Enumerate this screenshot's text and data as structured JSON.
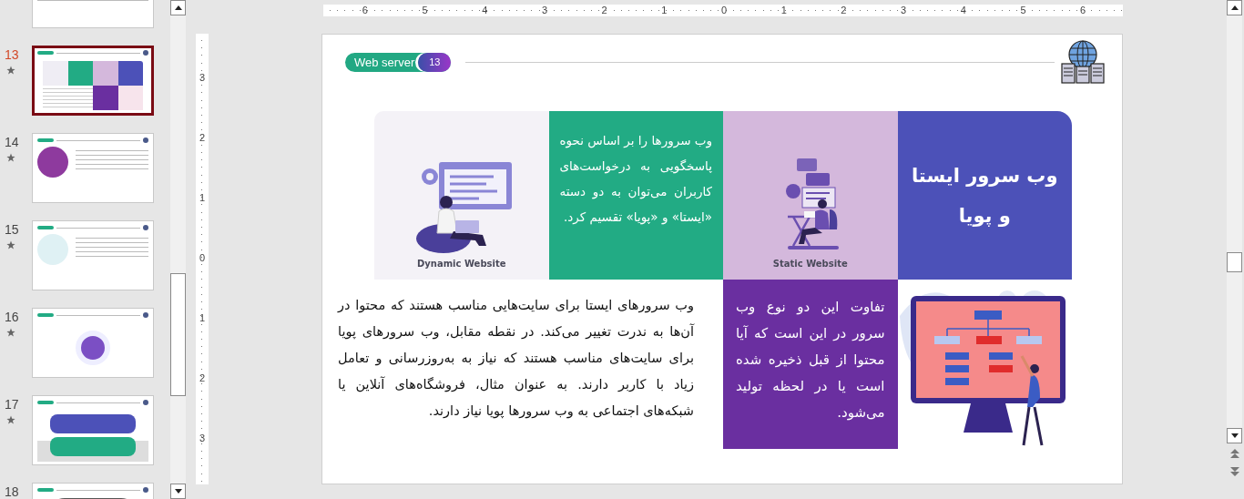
{
  "thumbnails": [
    {
      "kind": "text",
      "selected": false,
      "star": false
    },
    {
      "number": "13",
      "kind": "grid",
      "selected": true,
      "star": true
    },
    {
      "number": "14",
      "kind": "circle-list",
      "selected": false,
      "star": true
    },
    {
      "number": "15",
      "kind": "monitor-list",
      "selected": false,
      "star": true
    },
    {
      "number": "16",
      "kind": "diagram",
      "selected": false,
      "star": true
    },
    {
      "number": "17",
      "kind": "cards",
      "selected": false,
      "star": true
    },
    {
      "number": "18",
      "kind": "photo",
      "selected": false,
      "star": false
    }
  ],
  "ruler": {
    "horizontal": [
      "6",
      "5",
      "4",
      "3",
      "2",
      "1",
      "0",
      "1",
      "2",
      "3",
      "4",
      "5",
      "6"
    ],
    "vertical": [
      "3",
      "2",
      "1",
      "0",
      "1",
      "2",
      "3"
    ]
  },
  "slide": {
    "badge": {
      "label": "Web server",
      "number": "13"
    },
    "title": "وب سرور ایستا و پویا",
    "intro": "وب سرورها را بر اساس نحوه پاسخگویی به درخواست‌های کاربران می‌توان به دو دسته «ایستا» و «پویا» تقسیم کرد.",
    "static_caption": "Static Website",
    "dynamic_caption": "Dynamic Website",
    "difference": "تفاوت این دو نوع وب سرور در این است که آیا محتوا از قبل ذخیره شده است یا در لحظه تولید می‌شود.",
    "paragraph": "وب سرورهای ایستا برای سایت‌هایی مناسب هستند که محتوا در آن‌ها به ندرت تغییر می‌کند. در نقطه مقابل، وب سرورهای پویا برای سایت‌های مناسب هستند که نیاز به به‌روزرسانی و تعامل زیاد با کاربر دارند. به عنوان مثال، فروشگاه‌های آنلاین یا شبکه‌های اجتماعی به وب سرورها پویا نیاز دارند."
  }
}
